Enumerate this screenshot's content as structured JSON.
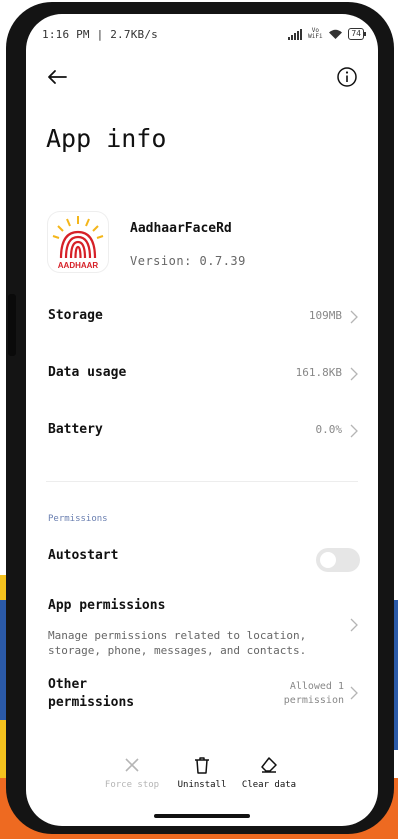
{
  "status_bar": {
    "time_and_speed": "1:16 PM | 2.7KB/s",
    "network_label": "Vo WiFi",
    "battery": "74"
  },
  "header": {
    "title": "App info",
    "back_icon": "arrow-left-icon",
    "info_icon": "info-circle-icon"
  },
  "app": {
    "name": "AadhaarFaceRd",
    "version": "Version: 0.7.39",
    "icon_text": "AADHAAR",
    "icon_colors": {
      "accent": "#d62027",
      "sun": "#f4b61a"
    }
  },
  "usage": [
    {
      "label": "Storage",
      "value": "109MB"
    },
    {
      "label": "Data usage",
      "value": "161.8KB"
    },
    {
      "label": "Battery",
      "value": "0.0%"
    }
  ],
  "permissions": {
    "section_label": "Permissions",
    "autostart": {
      "label": "Autostart",
      "enabled": false
    },
    "app_permissions": {
      "label": "App permissions",
      "description": "Manage permissions related to location, storage, phone, messages, and contacts."
    },
    "other_permissions": {
      "label": "Other permissions",
      "value": "Allowed 1 permission"
    }
  },
  "actions": [
    {
      "label": "Force stop",
      "icon": "close-icon",
      "disabled": true
    },
    {
      "label": "Uninstall",
      "icon": "trash-icon",
      "disabled": false
    },
    {
      "label": "Clear data",
      "icon": "eraser-icon",
      "disabled": false
    }
  ],
  "colors": {
    "text_primary": "#111111",
    "text_secondary": "#888888",
    "section_label": "#6a7fb0",
    "disabled": "#b5b5b5",
    "toggle_off": "#e6e6e6"
  }
}
